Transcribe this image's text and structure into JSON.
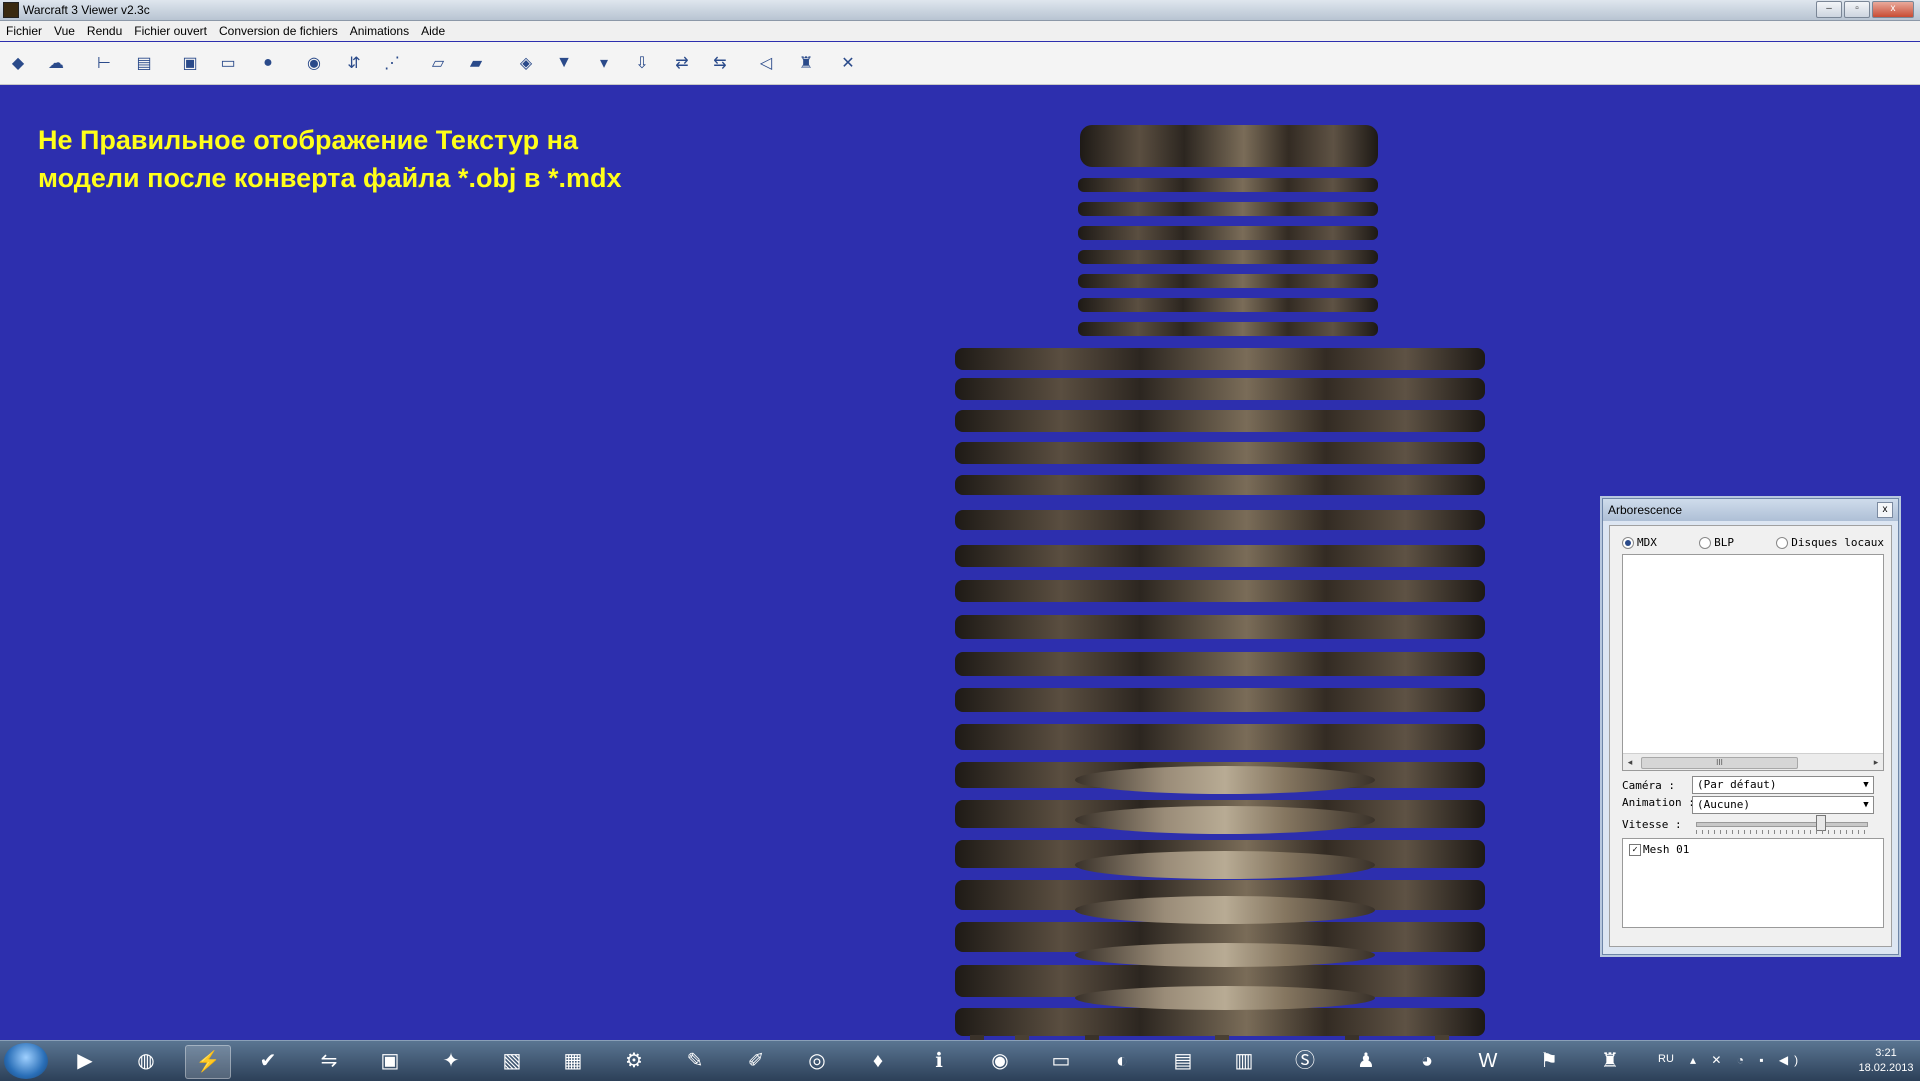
{
  "window": {
    "title": "Warcraft 3 Viewer v2.3c",
    "buttons": {
      "minimize": "‒",
      "maximize": "▫",
      "close": "x"
    }
  },
  "menu": [
    "Fichier",
    "Vue",
    "Rendu",
    "Fichier ouvert",
    "Conversion de fichiers",
    "Animations",
    "Aide"
  ],
  "toolbar": {
    "icons": [
      "open-model-icon",
      "mpq-icon",
      "tree-icon",
      "log-icon",
      "screenshot-icon",
      "monitor-icon",
      "sphere-icon",
      "rotate-icon",
      "blp-convert-icon",
      "dots-icon",
      "texture-icon",
      "texture-alt-icon",
      "tag-icon",
      "download-icon",
      "download-alt-icon",
      "blp-export-icon",
      "tga-blp-icon",
      "blp-tga-icon",
      "arrow-left-icon",
      "w3v-icon",
      "close-icon"
    ]
  },
  "viewport": {
    "background": "#2d2fae",
    "annotation_line1": "Не Правильное отображение Текстур на",
    "annotation_line2": "модели после конверта файла *.obj в *.mdx",
    "annotation_color": "#ffff1a"
  },
  "panel": {
    "title": "Arborescence",
    "close": "x",
    "radios": [
      {
        "label": "MDX",
        "selected": true
      },
      {
        "label": "BLP",
        "selected": false
      },
      {
        "label": "Disques locaux",
        "selected": false
      }
    ],
    "scroll_thumb": "III",
    "camera_label": "Caméra :",
    "camera_value": "(Par défaut)",
    "animation_label": "Animation :",
    "animation_value": "(Aucune)",
    "speed_label": "Vitesse :",
    "speed_level": 0.72,
    "mesh_checked": true,
    "mesh_label": "Mesh 01"
  },
  "taskbar": {
    "apps": [
      "media-player-icon",
      "firefox-icon",
      "winamp-icon",
      "checkmark-icon",
      "teamviewer-icon",
      "cs-icon",
      "3d-app-icon",
      "pdf-icon",
      "excel-icon",
      "settings-gear-icon",
      "pen-app-icon",
      "paint-app-icon",
      "opera-icon",
      "joystick-icon",
      "info-icon",
      "warcraft-orb-icon",
      "folder-icon",
      "globe-icon",
      "explorer-icon",
      "chart-app-icon",
      "skype-icon",
      "agent-icon",
      "chrome-icon",
      "word-icon",
      "scroll-app-icon",
      "warcraft-viewer-icon"
    ],
    "active_index": 2,
    "lang": "RU",
    "tray": "▴ ✕ ◔ ▪ ◀)",
    "time": "3:21",
    "date": "18.02.2013"
  }
}
